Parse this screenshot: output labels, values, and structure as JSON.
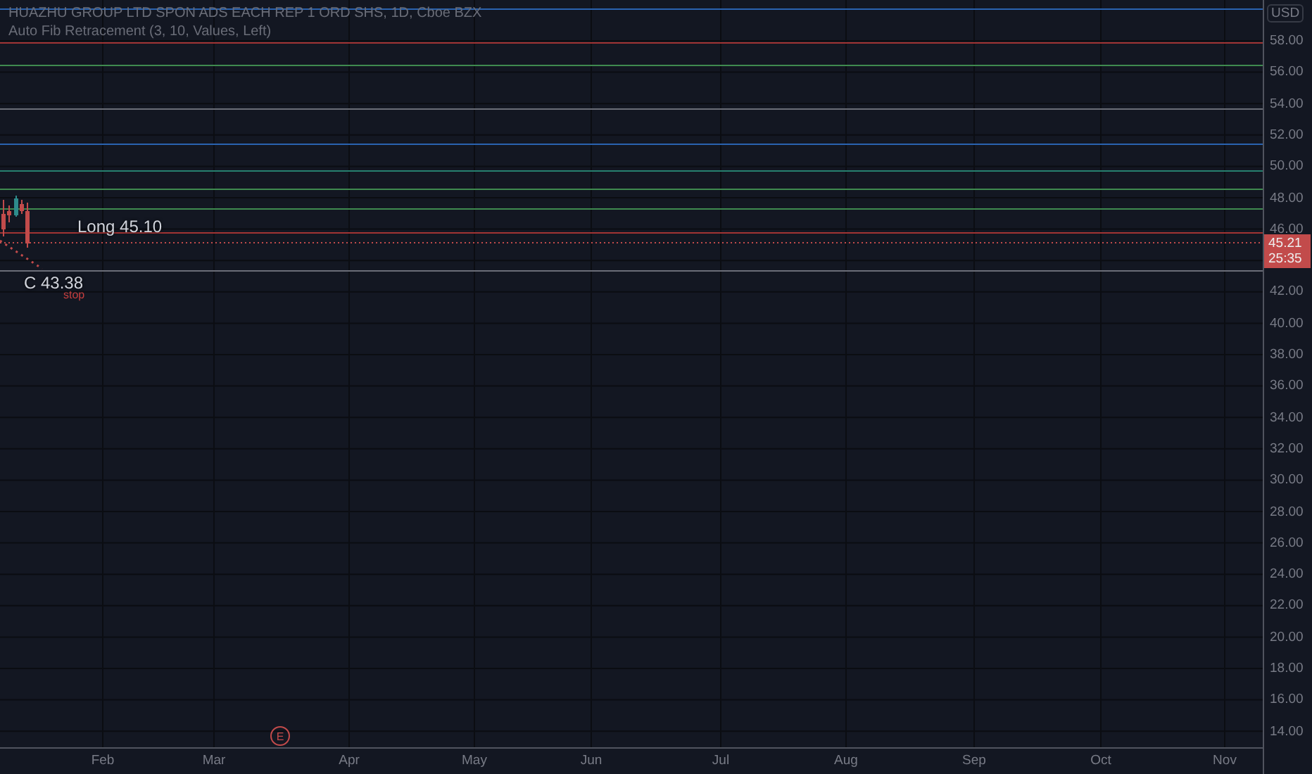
{
  "legend": {
    "symbol": "HUAZHU GROUP LTD SPON ADS EACH REP 1 ORD SHS, 1D, Cboe BZX",
    "indicator": "Auto Fib Retracement (3, 10, Values, Left)"
  },
  "annotations": [
    {
      "kind": "label",
      "text": "Long 45.10"
    },
    {
      "kind": "label",
      "text": "C 43.38"
    },
    {
      "kind": "note",
      "text": "stop"
    }
  ],
  "earnings_marker": "E",
  "price_axis": {
    "currency": "USD",
    "ticks": [
      "58.00",
      "56.00",
      "54.00",
      "52.00",
      "50.00",
      "48.00",
      "46.00",
      "42.00",
      "40.00",
      "38.00",
      "36.00",
      "34.00",
      "32.00",
      "30.00",
      "28.00",
      "26.00",
      "24.00",
      "22.00",
      "20.00",
      "18.00",
      "16.00",
      "14.00"
    ],
    "last_price": "45.21",
    "countdown": "25:35"
  },
  "time_axis": [
    "Feb",
    "Mar",
    "Apr",
    "May",
    "Jun",
    "Jul",
    "Aug",
    "Sep",
    "Oct",
    "Nov"
  ]
}
